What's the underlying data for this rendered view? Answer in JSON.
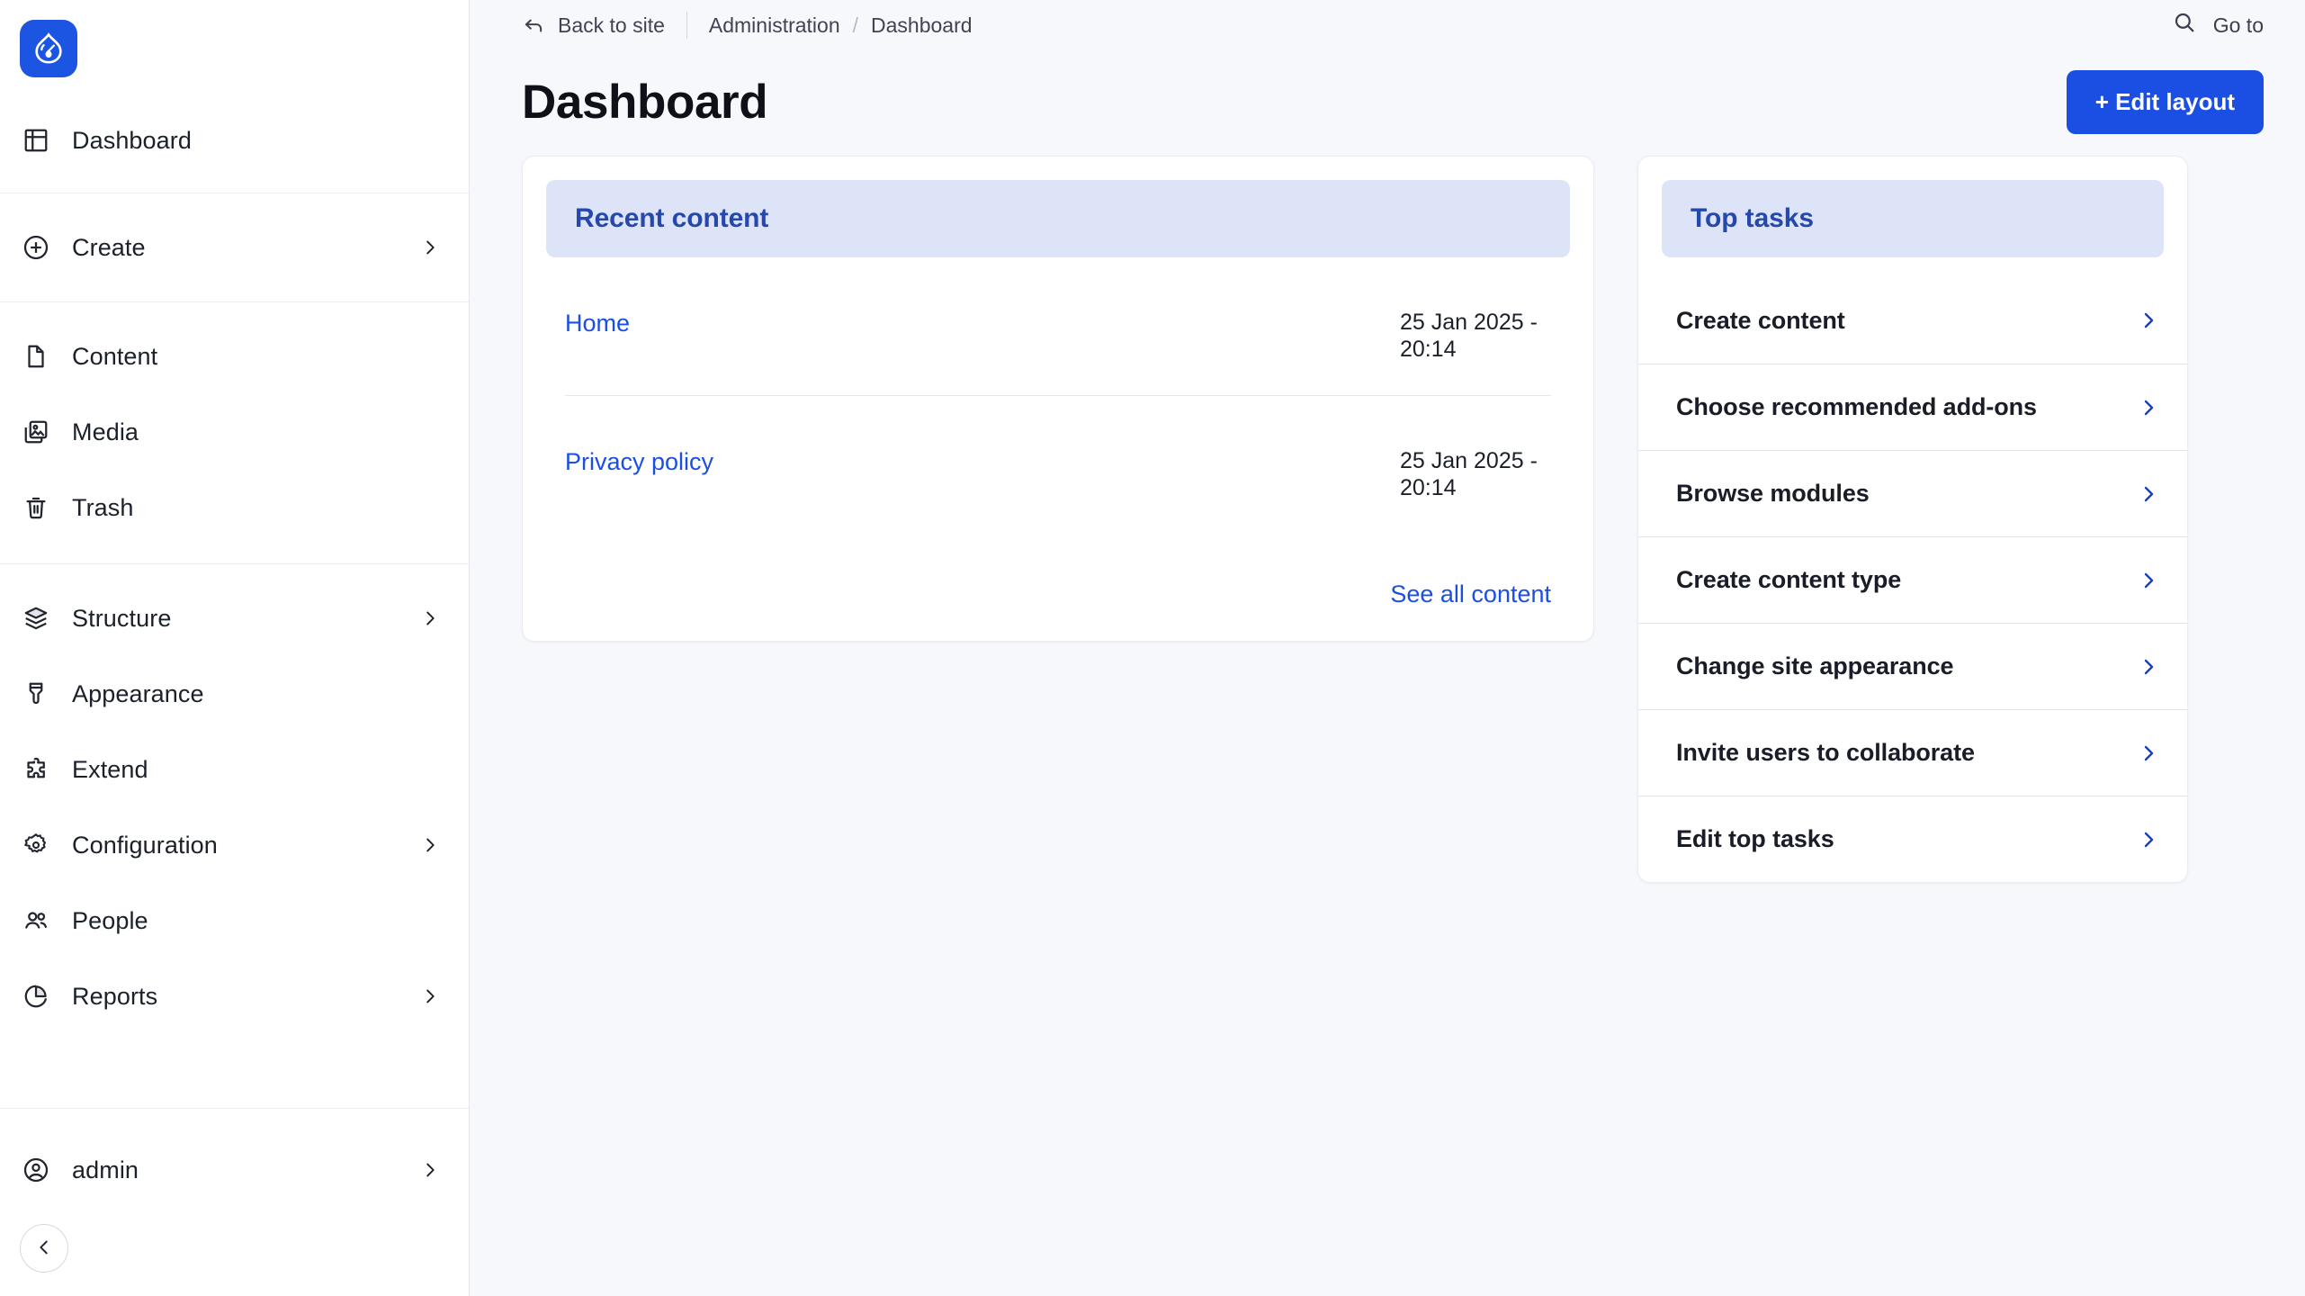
{
  "brand": {
    "logo_icon": "drupal-droplet-icon",
    "logo_bg": "#1b55e2"
  },
  "colors": {
    "accent": "#1b4fe4",
    "card_header_bg": "#dde4f8",
    "card_header_text": "#2648ad",
    "page_bg": "#f6f8fc",
    "sidebar_bg": "#ffffff"
  },
  "sidebar": {
    "groups": [
      {
        "items": [
          {
            "label": "Dashboard",
            "icon": "dashboard-grid-icon",
            "has_chevron": false
          }
        ]
      },
      {
        "items": [
          {
            "label": "Create",
            "icon": "plus-circle-icon",
            "has_chevron": true
          }
        ]
      },
      {
        "items": [
          {
            "label": "Content",
            "icon": "document-icon",
            "has_chevron": false
          },
          {
            "label": "Media",
            "icon": "image-stack-icon",
            "has_chevron": false
          },
          {
            "label": "Trash",
            "icon": "trash-icon",
            "has_chevron": false
          }
        ]
      },
      {
        "items": [
          {
            "label": "Structure",
            "icon": "layers-icon",
            "has_chevron": true
          },
          {
            "label": "Appearance",
            "icon": "paintbrush-icon",
            "has_chevron": false
          },
          {
            "label": "Extend",
            "icon": "puzzle-piece-icon",
            "has_chevron": false
          },
          {
            "label": "Configuration",
            "icon": "gear-icon",
            "has_chevron": true
          },
          {
            "label": "People",
            "icon": "users-icon",
            "has_chevron": false
          },
          {
            "label": "Reports",
            "icon": "pie-chart-icon",
            "has_chevron": true
          }
        ]
      }
    ],
    "footer": {
      "account": {
        "label": "admin",
        "icon": "user-circle-icon",
        "has_chevron": true
      },
      "collapse_icon": "chevron-left-icon"
    }
  },
  "topbar": {
    "back_to_site": "Back to site",
    "back_icon": "arrow-back-icon",
    "breadcrumb": {
      "parent": "Administration",
      "separator": "/",
      "current": "Dashboard"
    },
    "goto": {
      "label": "Go to",
      "icon": "search-icon"
    }
  },
  "page": {
    "title": "Dashboard",
    "edit_layout_label": "+ Edit layout"
  },
  "recent_content": {
    "heading": "Recent content",
    "rows": [
      {
        "title": "Home",
        "date": "25 Jan 2025 - 20:14"
      },
      {
        "title": "Privacy policy",
        "date": "25 Jan 2025 - 20:14"
      }
    ],
    "see_all_label": "See all content"
  },
  "top_tasks": {
    "heading": "Top tasks",
    "items": [
      {
        "label": "Create content",
        "chevron_icon": "chevron-right-icon"
      },
      {
        "label": "Choose recommended add-ons",
        "chevron_icon": "chevron-right-icon"
      },
      {
        "label": "Browse modules",
        "chevron_icon": "chevron-right-icon"
      },
      {
        "label": "Create content type",
        "chevron_icon": "chevron-right-icon"
      },
      {
        "label": "Change site appearance",
        "chevron_icon": "chevron-right-icon"
      },
      {
        "label": "Invite users to collaborate",
        "chevron_icon": "chevron-right-icon"
      },
      {
        "label": "Edit top tasks",
        "chevron_icon": "chevron-right-icon"
      }
    ]
  }
}
